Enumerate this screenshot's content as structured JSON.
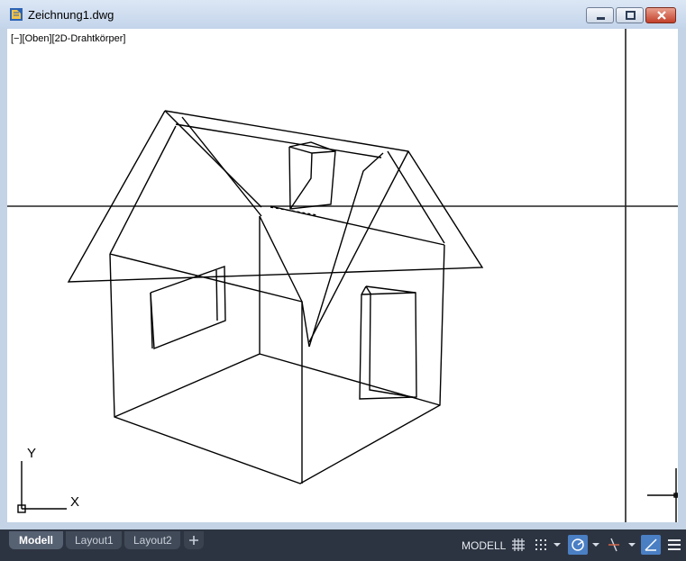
{
  "window": {
    "title": "Zeichnung1.dwg"
  },
  "viewport": {
    "label": "[−][Oben][2D-Drahtkörper]",
    "axis_y": "Y",
    "axis_x": "X"
  },
  "tabs": [
    {
      "label": "Modell",
      "active": true
    },
    {
      "label": "Layout1",
      "active": false
    },
    {
      "label": "Layout2",
      "active": false
    }
  ],
  "status": {
    "space": "MODELL",
    "icons": [
      "grid-icon",
      "snap-icon",
      "dropdown-icon",
      "polar-tracking-icon",
      "dropdown-icon",
      "ortho-icon",
      "dropdown-icon",
      "isodraft-icon",
      "menu-icon"
    ]
  },
  "colors": {
    "accent": "#4a7fc4",
    "statusbar": "#2d3441",
    "frame": "#c4d3e6"
  }
}
